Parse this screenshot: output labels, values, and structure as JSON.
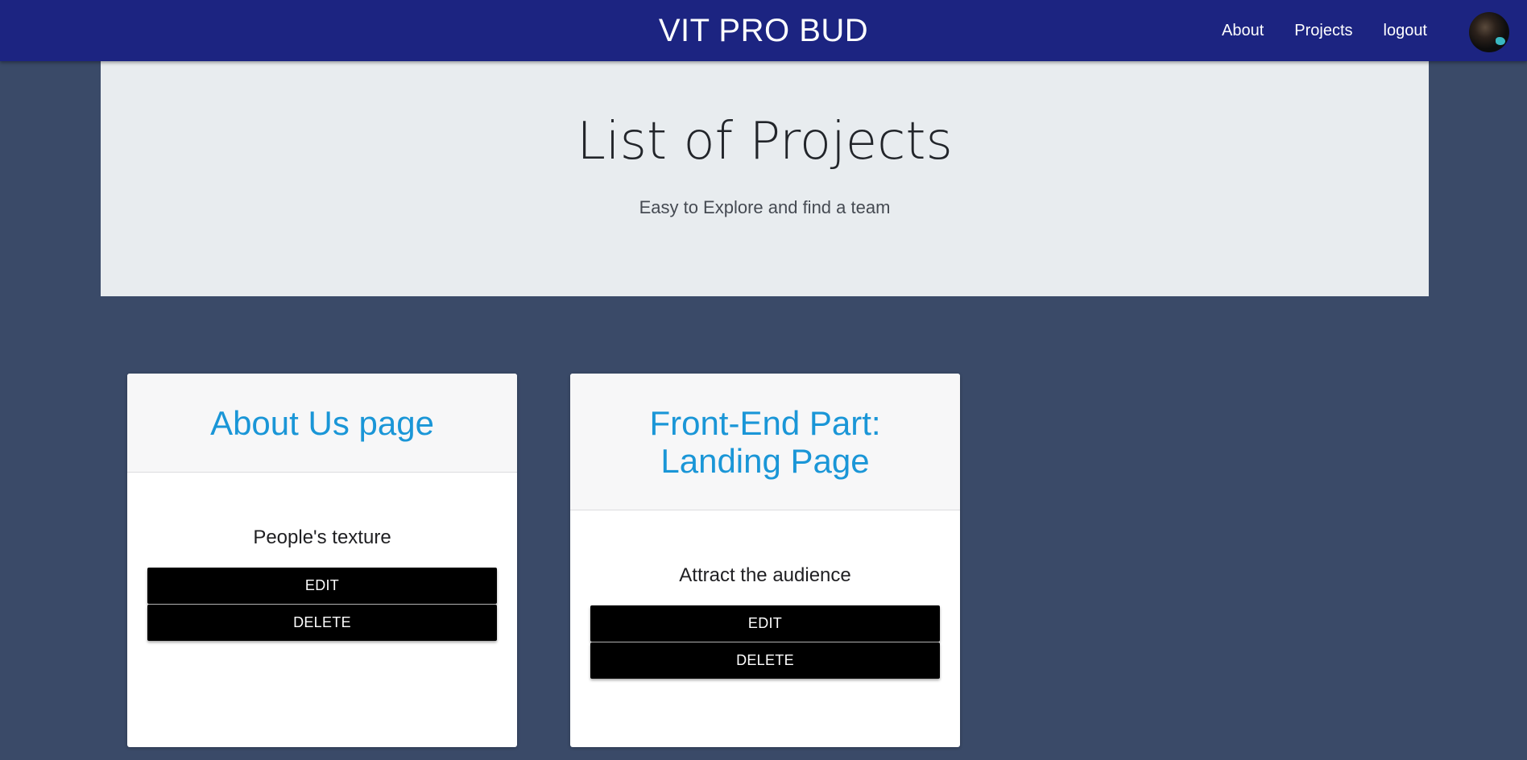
{
  "navbar": {
    "brand": "VIT PRO BUD",
    "links": [
      {
        "label": "About"
      },
      {
        "label": "Projects"
      },
      {
        "label": "logout"
      }
    ],
    "background_color": "#1c2481"
  },
  "hero": {
    "title": "List of Projects",
    "subtitle": "Easy to Explore and find a team"
  },
  "projects": [
    {
      "title": "About Us page",
      "description": "People's texture",
      "edit_label": "EDIT",
      "delete_label": "DELETE"
    },
    {
      "title": "Front-End Part: Landing Page",
      "description": "Attract the audience",
      "edit_label": "EDIT",
      "delete_label": "DELETE"
    }
  ],
  "colors": {
    "page_background": "#3a4a68",
    "hero_background": "#e8ecef",
    "card_title": "#1a96d7",
    "button_background": "#000000"
  }
}
